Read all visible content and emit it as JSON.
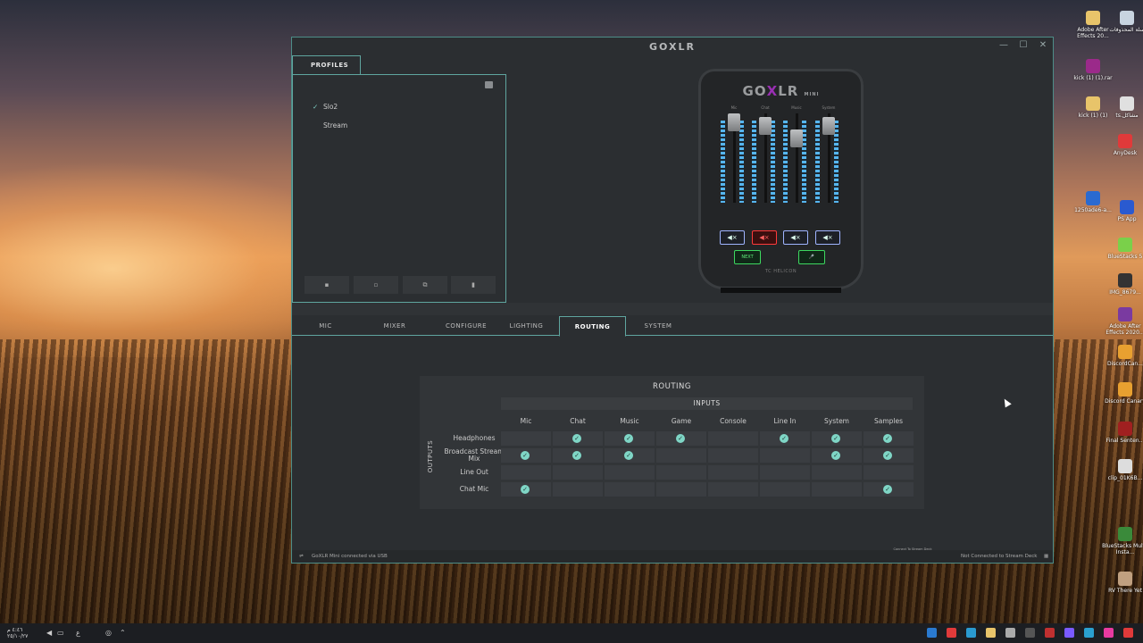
{
  "window": {
    "title": "GOXLR"
  },
  "profiles": {
    "tab_label": "PROFILES",
    "items": [
      {
        "label": "Slo2",
        "selected": true
      },
      {
        "label": "Stream",
        "selected": false
      }
    ],
    "buttons": [
      "save-icon",
      "new-icon",
      "copy-icon",
      "delete-icon"
    ]
  },
  "device": {
    "logo_prefix": "GO",
    "logo_x": "X",
    "logo_suffix": "LR",
    "model": "MINI",
    "channels": [
      "Mic",
      "Chat",
      "Music",
      "System"
    ],
    "mute_glyph": "◀×",
    "fx_left": "NEXT",
    "fx_right": "🎤",
    "brand": "TC HELICON"
  },
  "tabs": [
    {
      "label": "MIC",
      "active": false
    },
    {
      "label": "MIXER",
      "active": false
    },
    {
      "label": "CONFIGURE",
      "active": false
    },
    {
      "label": "LIGHTING",
      "active": false
    },
    {
      "label": "ROUTING",
      "active": true
    },
    {
      "label": "SYSTEM",
      "active": false
    }
  ],
  "routing": {
    "title": "ROUTING",
    "inputs_label": "INPUTS",
    "outputs_label": "OUTPUTS",
    "columns": [
      "Mic",
      "Chat",
      "Music",
      "Game",
      "Console",
      "Line In",
      "System",
      "Samples"
    ],
    "rows": [
      {
        "label": "Headphones",
        "enabled": [
          false,
          true,
          true,
          true,
          false,
          true,
          true,
          true
        ]
      },
      {
        "label": "Broadcast Stream Mix",
        "enabled": [
          true,
          true,
          true,
          false,
          false,
          false,
          true,
          true
        ]
      },
      {
        "label": "Line Out",
        "enabled": [
          false,
          false,
          false,
          false,
          false,
          false,
          false,
          false
        ]
      },
      {
        "label": "Chat Mic",
        "enabled": [
          true,
          false,
          false,
          false,
          false,
          false,
          false,
          true
        ]
      }
    ]
  },
  "status": {
    "usb": "GoXLR Mini connected via USB",
    "stream_deck_btn": "Connect To Stream Deck",
    "stream_deck": "Not Connected to Stream Deck"
  },
  "desktop_icons": [
    {
      "label": "Adobe After Effects 20...",
      "color": "#e8c46a"
    },
    {
      "label": "سلة المحذوفات",
      "color": "#c8d4e0"
    },
    {
      "label": "kick (1) (1).rar",
      "color": "#9b2a8a"
    },
    {
      "label": "kick (1) (1)",
      "color": "#e8c46a"
    },
    {
      "label": "ts.مشاكل",
      "color": "#e0e0e0"
    },
    {
      "label": "AnyDesk",
      "color": "#e03a3a"
    },
    {
      "label": "1250ade6-a...",
      "color": "#2a6ad0"
    },
    {
      "label": "PS App",
      "color": "#2a5ad0"
    },
    {
      "label": "BlueStacks 5",
      "color": "#7ad04a"
    },
    {
      "label": "IMG_8679...",
      "color": "#333"
    },
    {
      "label": "Adobe After Effects 2020...",
      "color": "#7a3aa0"
    },
    {
      "label": "DiscordCan...",
      "color": "#e8a030"
    },
    {
      "label": "Discord Canary",
      "color": "#e8a030"
    },
    {
      "label": "Final Senten...",
      "color": "#a02020"
    },
    {
      "label": "clip_01K6B...",
      "color": "#ddd"
    },
    {
      "label": "BlueStacks Multi-Insta...",
      "color": "#3a8a3a"
    },
    {
      "label": "RV There Yet",
      "color": "#c0a080"
    }
  ],
  "taskbar": {
    "time": "٤:٤٦ م",
    "date": "٢٥/١٠/٢٧",
    "lang": "ع",
    "icons": [
      "#2a7ad0",
      "#e03a3a",
      "#2a9ad0",
      "#e8c46a",
      "#aaaaaa",
      "#555",
      "#c03030",
      "#7a5aff",
      "#2aa0d0",
      "#e83aa0",
      "#e03a3a",
      "#ffffff",
      "#2a7ad0"
    ]
  }
}
